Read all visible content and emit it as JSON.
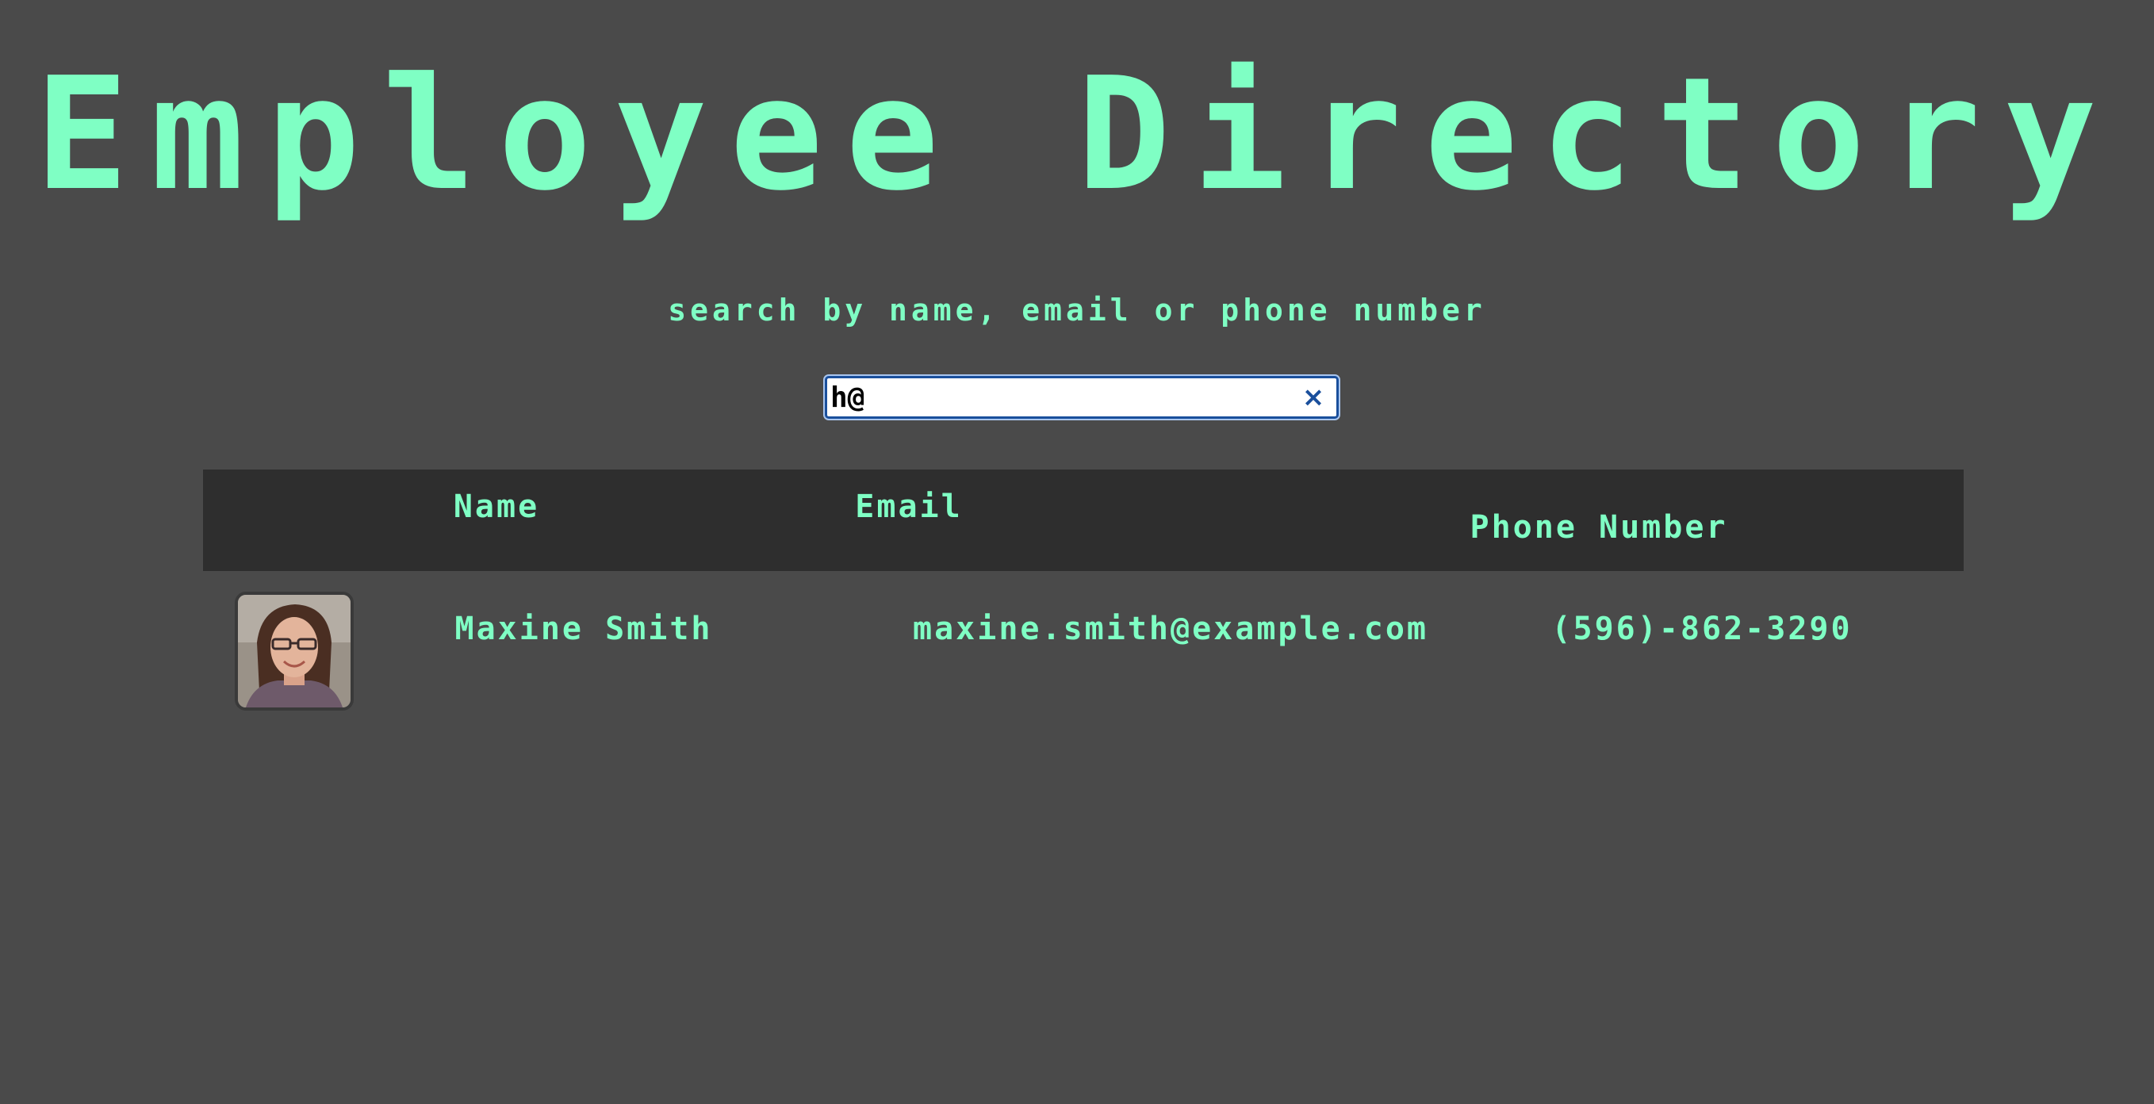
{
  "page": {
    "title": "Employee Directory",
    "subtitle": "search by name, email or phone number"
  },
  "search": {
    "value": "h@",
    "clear_icon": "×"
  },
  "table": {
    "headers": [
      "Name",
      "Email",
      "Phone Number"
    ],
    "rows": [
      {
        "name": "Maxine Smith",
        "email": "maxine.smith@example.com",
        "phone": "(596)-862-3290"
      }
    ]
  },
  "colors": {
    "background": "#4a4a4a",
    "accent": "#7fffc4",
    "header_bg": "#2e2e2e",
    "input_border": "#1a4f9c"
  }
}
